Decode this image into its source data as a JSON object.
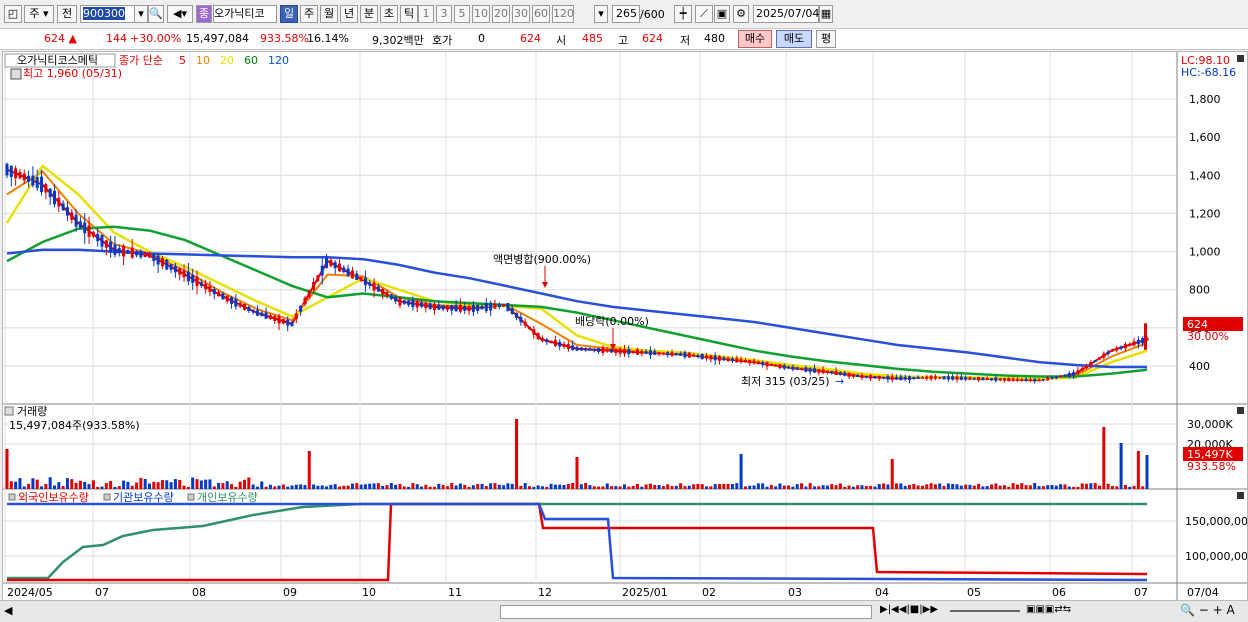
{
  "toolbar": {
    "period_mode": "주",
    "code_label": "전",
    "stock_code": "900300",
    "market_tag": "종",
    "stock_name": "오가닉티코",
    "tabs": [
      "일",
      "주",
      "월",
      "년",
      "분",
      "초",
      "틱"
    ],
    "active_tab": "일",
    "minute_options": [
      "1",
      "3",
      "5",
      "10",
      "20",
      "30",
      "60",
      "120"
    ],
    "count_display": "265",
    "count_max": "/600",
    "date": "2025/07/04"
  },
  "info": {
    "price": "624",
    "change": "144",
    "change_pct": "+30.00%",
    "volume": "15,497,084",
    "vol_ratio": "933.58%",
    "turnover": "16.14%",
    "amount": "9,302백만",
    "quote_label": "호가",
    "quote_value": "0",
    "quote_price": "624",
    "open_label": "시",
    "open_value": "485",
    "high_label": "고",
    "high_value": "624",
    "low_label": "저",
    "low_value": "480",
    "buy_label": "매수",
    "sell_label": "매도",
    "p_label": "평"
  },
  "price_panel": {
    "title": "오가닉티코스메틱",
    "ma_label": "종가 단순",
    "ma_periods": [
      {
        "period": "5",
        "color": "#e00000"
      },
      {
        "period": "10",
        "color": "#f08000"
      },
      {
        "period": "20",
        "color": "#e8e000"
      },
      {
        "period": "60",
        "color": "#008000"
      },
      {
        "period": "120",
        "color": "#0050d0"
      }
    ],
    "high_note": "최고 1,960 (05/31)",
    "low_note": "최저 315 (03/25)",
    "event1": "액면병합(900.00%)",
    "event2": "배당락(0.00%)",
    "lc_label": "LC:98.10",
    "hc_label": "HC:-68.16",
    "price_tag": "624",
    "pct_tag": "30.00%"
  },
  "volume_panel": {
    "title": "거래량",
    "value_note": "15,497,084주(933.58%)",
    "vol_tag": "15,497K",
    "pct_tag": "933.58%"
  },
  "holding_panel": {
    "legend": [
      "외국인보유수량",
      "기관보유수량",
      "개인보유수량"
    ]
  },
  "axis": {
    "price_ticks": [
      "1,800",
      "1,600",
      "1,400",
      "1,200",
      "1,000",
      "800",
      "600",
      "400"
    ],
    "volume_ticks": [
      "30,000K",
      "20,000K"
    ],
    "holding_ticks": [
      "150,000,00",
      "100,000,00"
    ],
    "x_labels": [
      "2024/05",
      "07",
      "08",
      "09",
      "10",
      "11",
      "12",
      "2025/01",
      "02",
      "03",
      "04",
      "05",
      "06",
      "07"
    ],
    "x_end_label": "07/04"
  },
  "colors": {
    "up": "#e00000",
    "down": "#0038c8",
    "ma5": "#e00000",
    "ma10": "#f08000",
    "ma20": "#e8e000",
    "ma60": "#10a030",
    "ma120": "#2850d8"
  },
  "chart_data": {
    "type": "line",
    "price_range": [
      300,
      2000
    ],
    "grid": true,
    "series": [
      {
        "name": "5",
        "values": [
          1430,
          1350,
          1150,
          1010,
          980,
          880,
          770,
          680,
          620,
          950,
          850,
          740,
          710,
          700,
          720,
          540,
          490,
          480,
          470,
          460,
          440,
          420,
          390,
          370,
          345,
          335,
          340,
          335,
          330,
          325,
          360,
          480,
          540
        ]
      },
      {
        "name": "10",
        "values": [
          1300,
          1420,
          1200,
          1040,
          990,
          900,
          790,
          700,
          640,
          880,
          870,
          760,
          720,
          710,
          720,
          620,
          510,
          490,
          475,
          465,
          445,
          425,
          395,
          375,
          350,
          340,
          340,
          338,
          332,
          330,
          350,
          450,
          520
        ]
      },
      {
        "name": "20",
        "values": [
          1150,
          1450,
          1300,
          1100,
          1000,
          920,
          830,
          740,
          660,
          760,
          860,
          800,
          740,
          720,
          715,
          700,
          560,
          500,
          480,
          470,
          450,
          430,
          405,
          385,
          360,
          345,
          342,
          340,
          336,
          332,
          340,
          420,
          480
        ]
      },
      {
        "name": "60",
        "values": [
          950,
          1050,
          1120,
          1130,
          1110,
          1060,
          980,
          900,
          820,
          760,
          780,
          760,
          740,
          730,
          720,
          710,
          680,
          640,
          600,
          560,
          520,
          480,
          450,
          425,
          405,
          385,
          370,
          360,
          350,
          345,
          345,
          360,
          380
        ]
      },
      {
        "name": "120",
        "values": [
          990,
          1010,
          1010,
          1000,
          990,
          985,
          980,
          975,
          970,
          970,
          960,
          930,
          890,
          860,
          820,
          780,
          740,
          710,
          690,
          670,
          650,
          630,
          600,
          570,
          540,
          510,
          490,
          470,
          445,
          420,
          405,
          395,
          395
        ]
      }
    ]
  }
}
